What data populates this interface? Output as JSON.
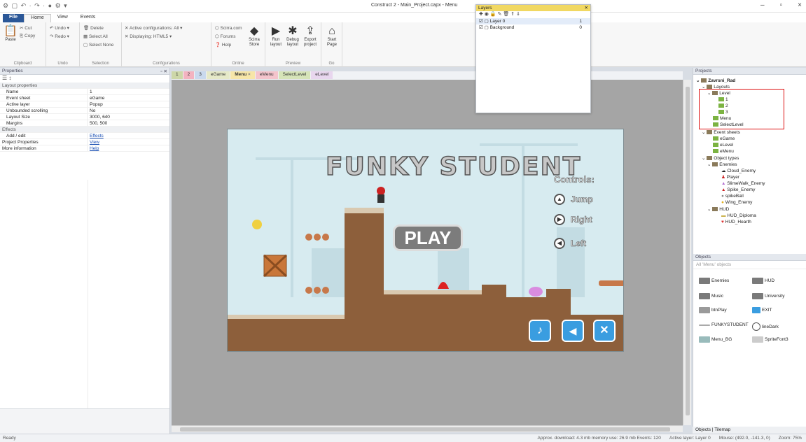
{
  "window": {
    "title": "Construct 2 - Main_Project.capx - Menu",
    "minimize": "–",
    "maximize": "▫",
    "close": "×"
  },
  "ribbon": {
    "tabs": [
      "File",
      "Home",
      "View",
      "Events"
    ],
    "clipboard": {
      "cut": "Cut",
      "copy": "Copy",
      "paste": "Paste",
      "label": "Clipboard"
    },
    "undo": {
      "undo": "Undo",
      "redo": "Redo",
      "label": "Undo"
    },
    "selection": {
      "delete": "Delete",
      "select_all": "Select All",
      "select_none": "Select None",
      "label": "Selection"
    },
    "configurations": {
      "active": "Active configurations: All",
      "displaying": "Displaying: HTML5",
      "label": "Configurations"
    },
    "online": {
      "scirra": "Scirra.com",
      "forums": "Forums",
      "help": "Help",
      "store": "Scirra Store",
      "label": "Online"
    },
    "preview": {
      "run": "Run layout",
      "debug": "Debug layout",
      "export": "Export project",
      "label": "Preview"
    },
    "go": {
      "start": "Start Page",
      "label": "Go"
    }
  },
  "properties": {
    "header": "Properties",
    "section": "Layout properties",
    "rows": [
      {
        "k": "Name",
        "v": "1"
      },
      {
        "k": "Event sheet",
        "v": "eGame"
      },
      {
        "k": "Active layer",
        "v": "Popup"
      },
      {
        "k": "Unbounded scrolling",
        "v": "No"
      },
      {
        "k": "Layout Size",
        "v": "3000, 640"
      },
      {
        "k": "Margins",
        "v": "500, 500"
      }
    ],
    "effects_section": "Effects",
    "add_edit": "Add / edit",
    "effects_link": "Effects",
    "project_props": "Project Properties",
    "view_link": "View",
    "more_info": "More information",
    "help_link": "Help"
  },
  "layout_tabs": [
    "1",
    "2",
    "3",
    "eGame",
    "Menu",
    "eMenu",
    "SelectLevel",
    "eLevel"
  ],
  "game": {
    "title": "FUNKY STUDENT",
    "play": "PLAY",
    "controls_title": "Controls:",
    "controls": [
      "Jump",
      "Right",
      "Left"
    ]
  },
  "layers": {
    "header": "Layers",
    "rows": [
      {
        "name": "Layer 0",
        "n": "1"
      },
      {
        "name": "Background",
        "n": "0"
      }
    ]
  },
  "projects": {
    "header": "Projects",
    "root": "Zavrsni_Rad",
    "layouts": "Layouts",
    "level": "Level",
    "level_items": [
      "1",
      "2",
      "3"
    ],
    "menu": "Menu",
    "select_level": "SelectLevel",
    "event_sheets": "Event sheets",
    "sheets": [
      "eGame",
      "eLevel",
      "eMenu"
    ],
    "object_types": "Object types",
    "enemies": "Enemies",
    "enemy_items": [
      "Cloud_Enemy",
      "Player",
      "SlimeWalk_Enemy",
      "Spike_Enemy",
      "spikeBall",
      "Wing_Enemy"
    ],
    "hud": "HUD",
    "hud_items": [
      "HUD_Diploma",
      "HUD_Hearth"
    ]
  },
  "objects": {
    "header": "Objects",
    "filter": "All 'Menu' objects",
    "items": [
      "Enemies",
      "HUD",
      "Music",
      "University",
      "btnPlay",
      "EXIT",
      "FUNKYSTUDENT",
      "lineDark",
      "Menu_BG",
      "SpriteFont3"
    ],
    "tabs": [
      "Objects",
      "Tilemap"
    ]
  },
  "status": {
    "left": "Ready",
    "download": "Approx. download: 4.3 mb  memory use: 26.9 mb  Events: 120",
    "layer": "Active layer: Layer 0",
    "mouse": "Mouse: (492.0, -141.3, 0)",
    "zoom": "Zoom: 75%"
  }
}
